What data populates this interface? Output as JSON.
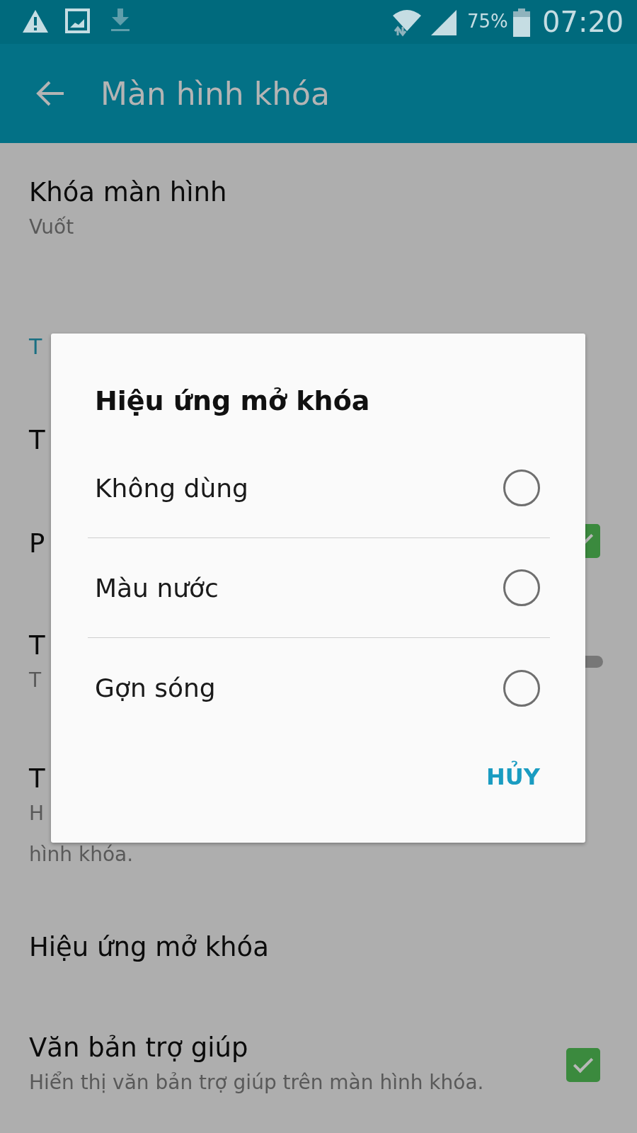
{
  "status_bar": {
    "battery_text": "75%",
    "time": "07:20"
  },
  "toolbar": {
    "title": "Màn hình khóa"
  },
  "settings": [
    {
      "kind": "item",
      "title": "Khóa màn hình",
      "subtitle_lines": [
        "Vuốt"
      ]
    },
    {
      "kind": "header",
      "title": "T"
    },
    {
      "kind": "item",
      "title": "T"
    },
    {
      "kind": "check",
      "title": "P",
      "checked": true
    },
    {
      "kind": "switch",
      "title": "T",
      "subtitle_lines": [
        "T"
      ],
      "on": false
    },
    {
      "kind": "item",
      "title": "T",
      "subtitle_lines": [
        "H",
        "hình khóa."
      ]
    },
    {
      "kind": "item",
      "title": "Hiệu ứng mở khóa"
    },
    {
      "kind": "check",
      "title": "Văn bản trợ giúp",
      "subtitle_lines": [
        "Hiển thị văn bản trợ giúp trên màn hình khóa."
      ],
      "checked": true
    }
  ],
  "dialog": {
    "title": "Hiệu ứng mở khóa",
    "options": [
      {
        "label": "Không dùng",
        "selected": false
      },
      {
        "label": "Màu nước",
        "selected": false
      },
      {
        "label": "Gợn sóng",
        "selected": false
      }
    ],
    "button": "HỦY"
  }
}
